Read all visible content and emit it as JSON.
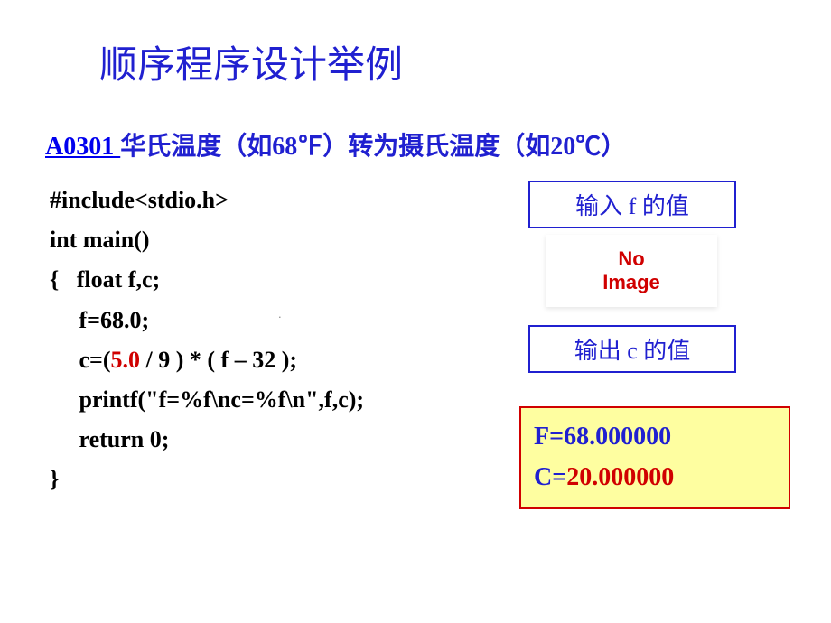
{
  "title": "顺序程序设计举例",
  "subtitle": {
    "link": "A0301 ",
    "text": "华氏温度（如68℉）转为摄氏温度（如20℃）"
  },
  "code": {
    "line1": "#include<stdio.h>",
    "line2": "int main()",
    "line3": "{   float f,c;",
    "line4": "     f=68.0;",
    "line5a": "     c=(",
    "line5_red": "5.0",
    "line5b": " / 9 ) * ( f – 32 );",
    "line6": "     printf(\"f=%f\\nc=%f\\n\",f,c);",
    "line7": "     return 0;",
    "line8": "}"
  },
  "sideboxes": {
    "input": "输入 f 的值",
    "noimage_l1": "No",
    "noimage_l2": "Image",
    "output": "输出 c 的值"
  },
  "result": {
    "line1_label": "F=",
    "line1_val": "68.000000",
    "line2_label": "C=",
    "line2_val": "20.000000"
  },
  "page_marker": "."
}
